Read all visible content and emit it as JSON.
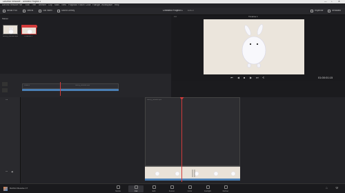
{
  "window": {
    "title": "DaVinci Resolve - Untitled Project 1",
    "controls": [
      "—",
      "□",
      "✕"
    ]
  },
  "menu": [
    "DaVinci Resolve",
    "File",
    "Edit",
    "Trim",
    "Timeline",
    "Clip",
    "Mark",
    "View",
    "Playback",
    "Fusion",
    "Color",
    "Fairlight",
    "Workspace",
    "Help"
  ],
  "toolbar": {
    "left_buttons": [
      "Media Pool",
      "Effects",
      "Edit Index",
      "Sound Library"
    ],
    "project_title": "Untitled Project 1",
    "project_status": "Edited",
    "right_buttons": [
      "Inspector",
      "Metadata"
    ]
  },
  "media_pool": {
    "bin": "Master",
    "clips": [
      {
        "label": "bunny_tutorial.mp4",
        "selected": false
      },
      {
        "label": "Timeline 1",
        "selected": true
      }
    ]
  },
  "viewer": {
    "timeline_name": "Timeline 1",
    "timecode": "01:00:01:15",
    "zoom": "1%"
  },
  "mini_timeline": {
    "clip_a": "Video 1",
    "clip_b": "bunny_tutorial.mp4"
  },
  "tracks": {
    "video_label": "V1",
    "audio_label": "A1"
  },
  "timeline_clip": {
    "label": "bunny_tutorial.mp4",
    "thumb_count": 7
  },
  "pages": [
    {
      "label": "Media",
      "active": false
    },
    {
      "label": "Cut",
      "active": true
    },
    {
      "label": "Edit",
      "active": false
    },
    {
      "label": "Fusion",
      "active": false
    },
    {
      "label": "Color",
      "active": false
    },
    {
      "label": "Fairlight",
      "active": false
    },
    {
      "label": "Deliver",
      "active": false
    }
  ],
  "app_name": "DaVinci Resolve 17",
  "colors": {
    "accent_red": "#d23b3b",
    "track_blue": "#4a7fb5",
    "viewer_bg": "#ebe5dc"
  }
}
